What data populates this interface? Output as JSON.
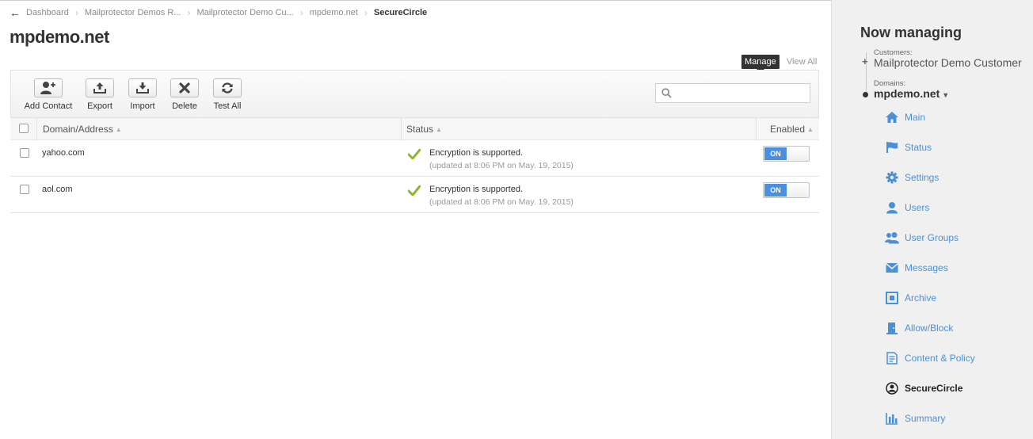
{
  "breadcrumb": {
    "items": [
      "Dashboard",
      "Mailprotector Demos R...",
      "Mailprotector Demo Cu...",
      "mpdemo.net"
    ],
    "current": "SecureCircle"
  },
  "page": {
    "title": "mpdemo.net"
  },
  "tooltip": {
    "text": "Manage"
  },
  "view_all": "View All",
  "toolbar": {
    "buttons": [
      {
        "label": "Add Contact",
        "icon": "add-contact-icon"
      },
      {
        "label": "Export",
        "icon": "export-icon"
      },
      {
        "label": "Import",
        "icon": "import-icon"
      },
      {
        "label": "Delete",
        "icon": "delete-icon"
      },
      {
        "label": "Test All",
        "icon": "refresh-icon"
      }
    ],
    "search": {
      "placeholder": "",
      "value": ""
    }
  },
  "table": {
    "columns": [
      "Domain/Address",
      "Status",
      "Enabled"
    ],
    "rows": [
      {
        "domain": "yahoo.com",
        "status": "Encryption is supported.",
        "updated": "(updated at 8:06 PM on May. 19, 2015)",
        "enabled": "ON"
      },
      {
        "domain": "aol.com",
        "status": "Encryption is supported.",
        "updated": "(updated at 8:06 PM on May. 19, 2015)",
        "enabled": "ON"
      }
    ]
  },
  "colors": {
    "accent": "#4a90e2",
    "link": "#4a90d6",
    "check": "#8bb82e",
    "sidebar_bg": "#f0f0f0"
  },
  "sidebar": {
    "title": "Now managing",
    "customers_label": "Customers:",
    "customer_name": "Mailprotector Demo Customer",
    "domains_label": "Domains:",
    "domain_name": "mpdemo.net",
    "nav": [
      {
        "label": "Main",
        "icon": "home-icon"
      },
      {
        "label": "Status",
        "icon": "flag-icon"
      },
      {
        "label": "Settings",
        "icon": "gear-icon"
      },
      {
        "label": "Users",
        "icon": "user-icon"
      },
      {
        "label": "User Groups",
        "icon": "user-groups-icon"
      },
      {
        "label": "Messages",
        "icon": "envelope-icon"
      },
      {
        "label": "Archive",
        "icon": "archive-icon"
      },
      {
        "label": "Allow/Block",
        "icon": "door-icon"
      },
      {
        "label": "Content & Policy",
        "icon": "document-icon"
      },
      {
        "label": "SecureCircle",
        "icon": "securecircle-icon",
        "active": true
      },
      {
        "label": "Summary",
        "icon": "bar-chart-icon"
      }
    ]
  }
}
